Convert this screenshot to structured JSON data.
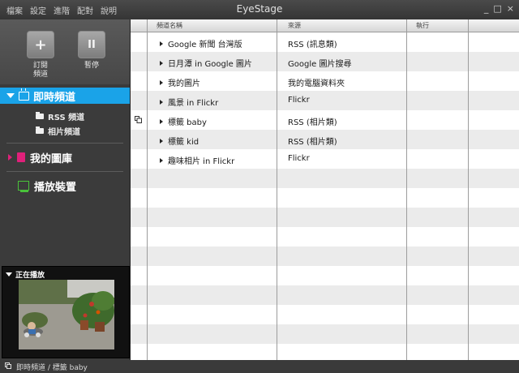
{
  "titlebar": {
    "menu": [
      "檔案",
      "設定",
      "進階",
      "配對",
      "說明"
    ],
    "title": "EyeStage",
    "controls": [
      "_",
      "□",
      "×"
    ]
  },
  "toolbar": {
    "subscribe_label_1": "訂閱",
    "subscribe_label_2": "頻道",
    "subscribe_icon": "+",
    "pause_label": "暫停",
    "pause_icon": "II"
  },
  "sidebar": {
    "active_section": "即時頻道",
    "sub_items": [
      "RSS 頻道",
      "相片頻道"
    ],
    "library": "我的圖庫",
    "player": "播放裝置",
    "accent_color": "#1aa3e8"
  },
  "now_playing": {
    "label": "正在播放"
  },
  "table": {
    "headers": [
      "頻道名稱",
      "來源",
      "執行"
    ],
    "rows": [
      {
        "name": "Google 新聞 台灣版",
        "source": "RSS (訊息類)"
      },
      {
        "name": "日月潭 in Google 圖片",
        "source": "Google 圖片搜尋"
      },
      {
        "name": "我的圖片",
        "source": "我的電腦資料夾"
      },
      {
        "name": "風景 in Flickr",
        "source": "Flickr"
      },
      {
        "name": "標籤 baby",
        "source": "RSS (相片類)"
      },
      {
        "name": "標籤 kid",
        "source": "RSS (相片類)"
      },
      {
        "name": "趣味相片 in Flickr",
        "source": "Flickr"
      }
    ]
  },
  "status": {
    "text": "即時頻道 / 標籤 baby"
  }
}
